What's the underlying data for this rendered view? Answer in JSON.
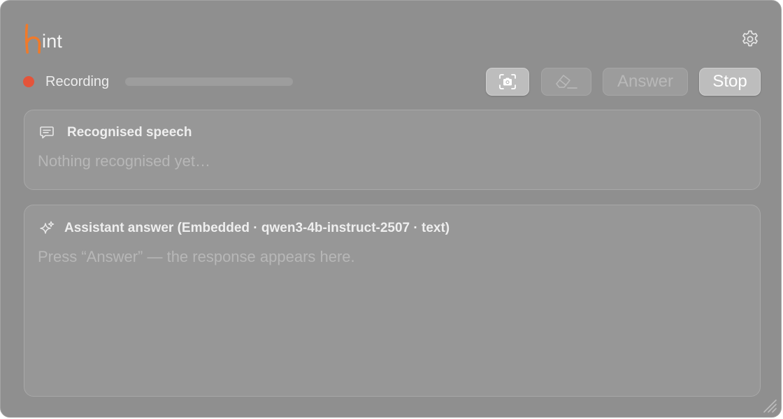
{
  "app": {
    "logo_mark": "h",
    "logo_text": "int",
    "logo_color": "#f07a2a"
  },
  "toolbar": {
    "recording_label": "Recording",
    "recording_dot_color": "#e4543a",
    "audio_level": 0,
    "screenshot_icon": "camera-viewfinder-icon",
    "clear_icon": "eraser-icon",
    "answer_label": "Answer",
    "stop_label": "Stop",
    "settings_icon": "gear-icon"
  },
  "speech_panel": {
    "icon": "chat-bubble-icon",
    "title": "Recognised speech",
    "placeholder": "Nothing recognised yet…"
  },
  "answer_panel": {
    "icon": "sparkles-icon",
    "title": "Assistant answer (Embedded · qwen3-4b-instruct-2507 · text)",
    "placeholder": "Press “Answer” — the response appears here."
  }
}
